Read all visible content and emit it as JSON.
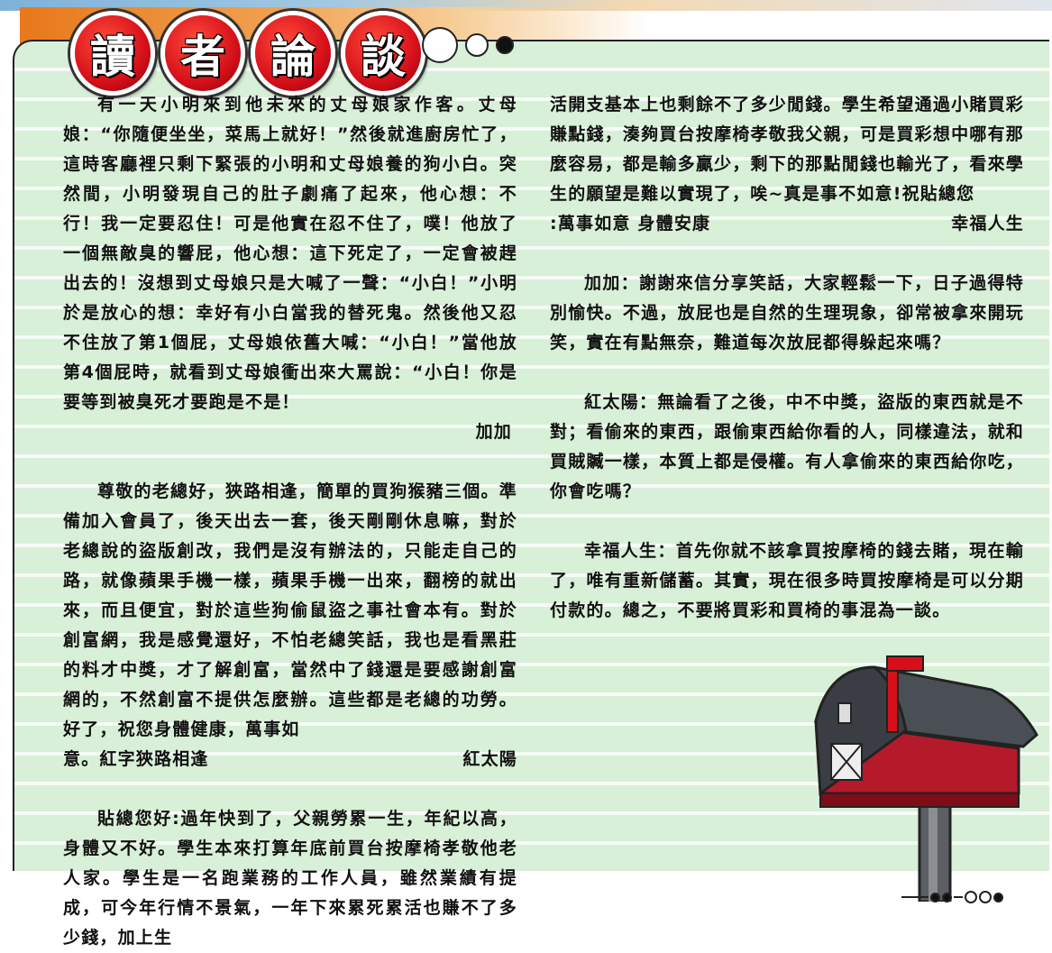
{
  "header": {
    "title_chars": [
      "讀",
      "者",
      "論",
      "談"
    ]
  },
  "left_column": {
    "p1": "有一天小明來到他未來的丈母娘家作客。丈母娘：“你隨便坐坐，菜馬上就好！”然後就進廚房忙了，這時客廳裡只剩下緊張的小明和丈母娘養的狗小白。突然間，小明發現自己的肚子劇痛了起來，他心想：不行！我一定要忍住！可是他實在忍不住了，噗！他放了一個無敵臭的響屁，他心想：這下死定了，一定會被趕出去的！沒想到丈母娘只是大喊了一聲：“小白！”小明於是放心的想：幸好有小白當我的替死鬼。然後他又忍不住放了第1個屁，丈母娘依舊大喊：“小白！”當他放第4個屁時，就看到丈母娘衝出來大罵說：“小白！你是要等到被臭死才要跑是不是！",
    "sig1": "加加",
    "p2": "尊敬的老總好，狹路相逢，簡單的買狗猴豬三個。準備加入會員了，後天出去一套，後天剛剛休息嘛，對於老總說的盜版創改，我們是沒有辦法的，只能走自己的路，就像蘋果手機一樣，蘋果手機一出來，翻榜的就出來，而且便宜，對於這些狗偷鼠盜之事社會本有。對於創富網，我是感覺還好，不怕老總笑話，我也是看黑莊的料才中獎，才了解創富，當然中了錢還是要感謝創富網的，不然創富不提供怎麼辦。這些都是老總的功勞。好了，祝您身體健康，萬事如",
    "p2_end": "意。紅字狹路相逢",
    "sig2": "紅太陽",
    "p3": "貼總您好:過年快到了，父親勞累一生，年紀以高，身體又不好。學生本來打算年底前買台按摩椅孝敬他老人家。學生是一名跑業務的工作人員，雖然業績有提成，可今年行情不景氣，一年下來累死累活也賺不了多少錢，加上生"
  },
  "right_column": {
    "p3_cont": "活開支基本上也剩餘不了多少閒錢。學生希望通過小賭買彩賺點錢，湊夠買台按摩椅孝敬我父親，可是買彩想中哪有那麼容易，都是輸多贏少，剩下的那點閒錢也輸光了，看來學生的願望是難以實現了，唉~真是事不如意!祝貼總您",
    "p3_end": ":萬事如意 身體安康",
    "sig3": "幸福人生",
    "r1": "加加：謝謝來信分享笑話，大家輕鬆一下，日子過得特別愉快。不過，放屁也是自然的生理現象，卻常被拿來開玩笑，實在有點無奈，難道每次放屁都得躲起來嗎？",
    "r2": "紅太陽：無論看了之後，中不中獎，盜版的東西就是不對；看偷來的東西，跟偷東西給你看的人，同樣違法，就和買賊贓一樣，本質上都是侵權。有人拿偷來的東西給你吃，你會吃嗎？",
    "r3": "幸福人生：首先你就不該拿買按摩椅的錢去賭，現在輸了，唯有重新儲蓄。其實，現在很多時買按摩椅是可以分期付款的。總之，不要將買彩和買椅的事混為一談。"
  },
  "colors": {
    "panel": "#d8efd8",
    "badge_red": "#d6101a",
    "banner_orange": "#e8781a",
    "mailbox_red": "#b51a2a",
    "mailbox_roof": "#4a4f55"
  },
  "icons": {
    "mailbox": "mailbox-illustration"
  }
}
